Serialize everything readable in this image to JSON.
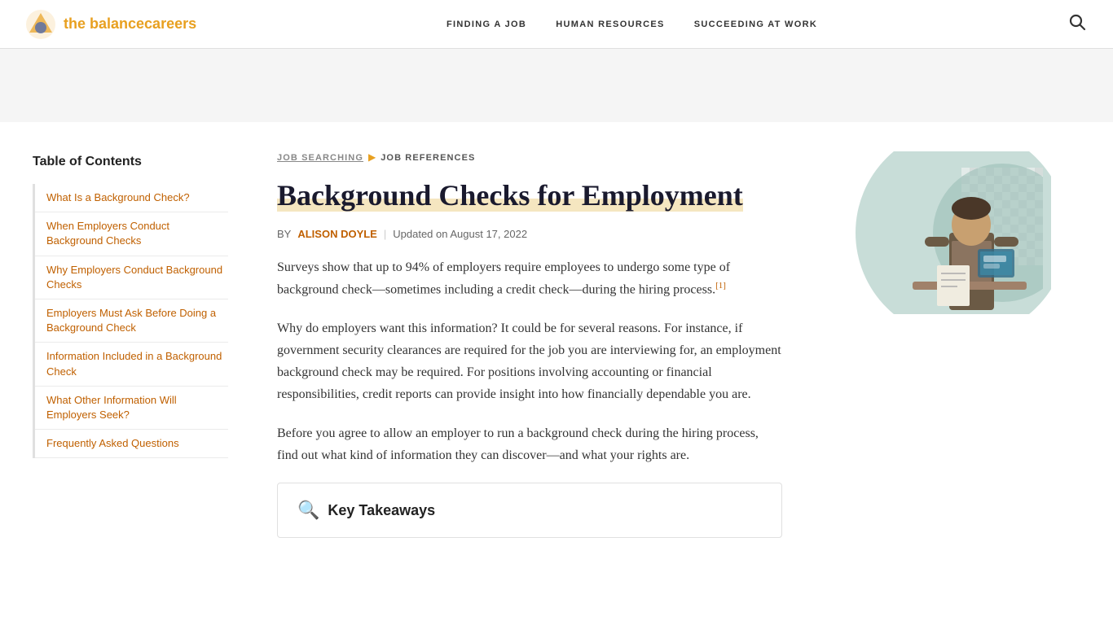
{
  "header": {
    "logo_text_main": "the balance",
    "logo_text_brand": "careers",
    "nav_items": [
      {
        "label": "FINDING A JOB",
        "id": "finding-a-job"
      },
      {
        "label": "HUMAN RESOURCES",
        "id": "human-resources"
      },
      {
        "label": "SUCCEEDING AT WORK",
        "id": "succeeding-at-work"
      }
    ]
  },
  "breadcrumb": {
    "item1": "JOB SEARCHING",
    "arrow": "▶",
    "item2": "JOB REFERENCES"
  },
  "article": {
    "title": "Background Checks for Employment",
    "author_label": "BY",
    "author_name": "ALISON DOYLE",
    "updated_text": "Updated on August 17, 2022",
    "body_p1": "Surveys show that up to 94% of employers require employees to undergo some type of background check—sometimes including a credit check—during the hiring process.",
    "footnote": "[1]",
    "body_p2": "Why do employers want this information? It could be for several reasons. For instance, if government security clearances are required for the job you are interviewing for, an employment background check may be required. For positions involving accounting or financial responsibilities, credit reports can provide insight into how financially dependable you are.",
    "body_p3": "Before you agree to allow an employer to run a background check during the hiring process, find out what kind of information they can discover—and what your rights are.",
    "takeaways_icon": "🔍",
    "takeaways_title": "Key Takeaways"
  },
  "toc": {
    "title": "Table of Contents",
    "items": [
      {
        "label": "What Is a Background Check?",
        "id": "toc-what"
      },
      {
        "label": "When Employers Conduct Background Checks",
        "id": "toc-when"
      },
      {
        "label": "Why Employers Conduct Background Checks",
        "id": "toc-why"
      },
      {
        "label": "Employers Must Ask Before Doing a Background Check",
        "id": "toc-ask"
      },
      {
        "label": "Information Included in a Background Check",
        "id": "toc-info"
      },
      {
        "label": "What Other Information Will Employers Seek?",
        "id": "toc-other"
      },
      {
        "label": "Frequently Asked Questions",
        "id": "toc-faq"
      }
    ]
  }
}
